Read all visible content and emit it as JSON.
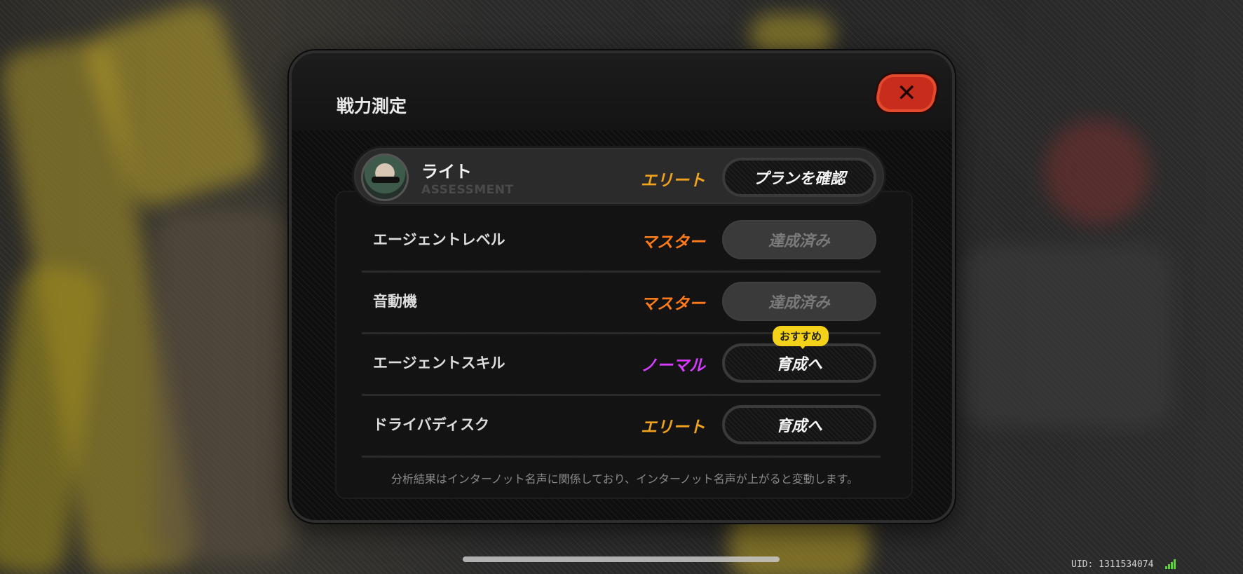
{
  "dialog": {
    "title": "戦力測定",
    "close_label": "✕"
  },
  "character": {
    "name": "ライト",
    "subtitle": "ASSESSMENT",
    "rank": "エリート",
    "button": "プランを確認"
  },
  "rows": [
    {
      "label": "エージェントレベル",
      "rank": "マスター",
      "button": "達成済み"
    },
    {
      "label": "音動機",
      "rank": "マスター",
      "button": "達成済み"
    },
    {
      "label": "エージェントスキル",
      "rank": "ノーマル",
      "button": "育成へ",
      "badge": "おすすめ"
    },
    {
      "label": "ドライバディスク",
      "rank": "エリート",
      "button": "育成へ"
    }
  ],
  "footnote": "分析結果はインターノット名声に関係しており、インターノット名声が上がると変動します。",
  "status": {
    "uid": "UID: 1311534074"
  },
  "colors": {
    "elite": "#f0a21d",
    "master": "#ff7a1a",
    "normal": "#d73bff",
    "close_button": "#c72c1c",
    "badge": "#f4d21a"
  }
}
